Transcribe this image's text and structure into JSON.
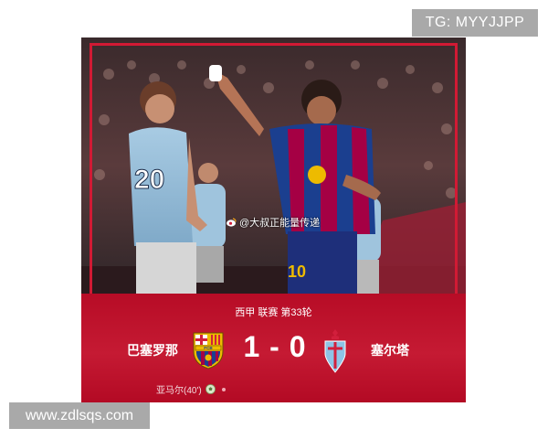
{
  "watermarks": {
    "telegram": "TG: MYYJJPP",
    "website": "www.zdlsqs.com"
  },
  "photo": {
    "weibo_credit": "@大叔正能量传递",
    "icon": "weibo-icon"
  },
  "match": {
    "league": "西甲 联赛 第33轮",
    "home_team": "巴塞罗那",
    "away_team": "塞尔塔",
    "home_score": "1",
    "away_score": "0",
    "score_separator": "-",
    "scorers": [
      {
        "text": "亚马尔(40')",
        "icon": "soccer-ball-icon"
      }
    ]
  },
  "colors": {
    "card_red": "#c00d2a",
    "barca_blue": "#1b3f8f",
    "barca_red": "#a50044",
    "celta_sky": "#8ec3e6",
    "gold": "#edbb00"
  }
}
